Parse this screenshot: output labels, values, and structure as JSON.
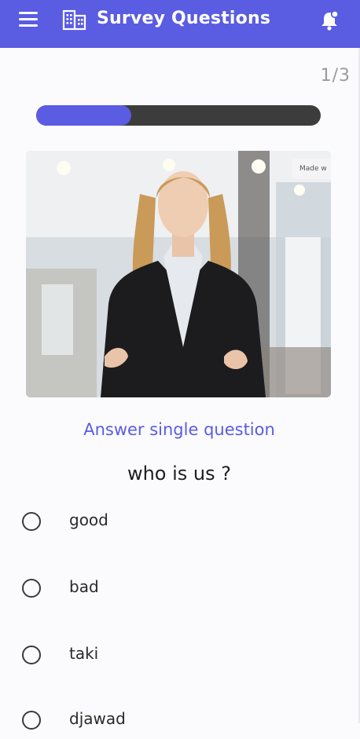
{
  "appbar": {
    "title": "Survey Questions",
    "menu_icon": "menu-icon",
    "logo_icon": "building-icon",
    "notification_icon": "bell-icon",
    "color": "#5a5ce2"
  },
  "survey": {
    "counter": "1/3",
    "progress": 0.333
  },
  "media": {
    "badge": "Made w"
  },
  "question": {
    "type_label": "Answer single question",
    "text": "who is us ?",
    "options": [
      {
        "label": "good"
      },
      {
        "label": "bad"
      },
      {
        "label": "taki"
      },
      {
        "label": "djawad"
      }
    ]
  }
}
